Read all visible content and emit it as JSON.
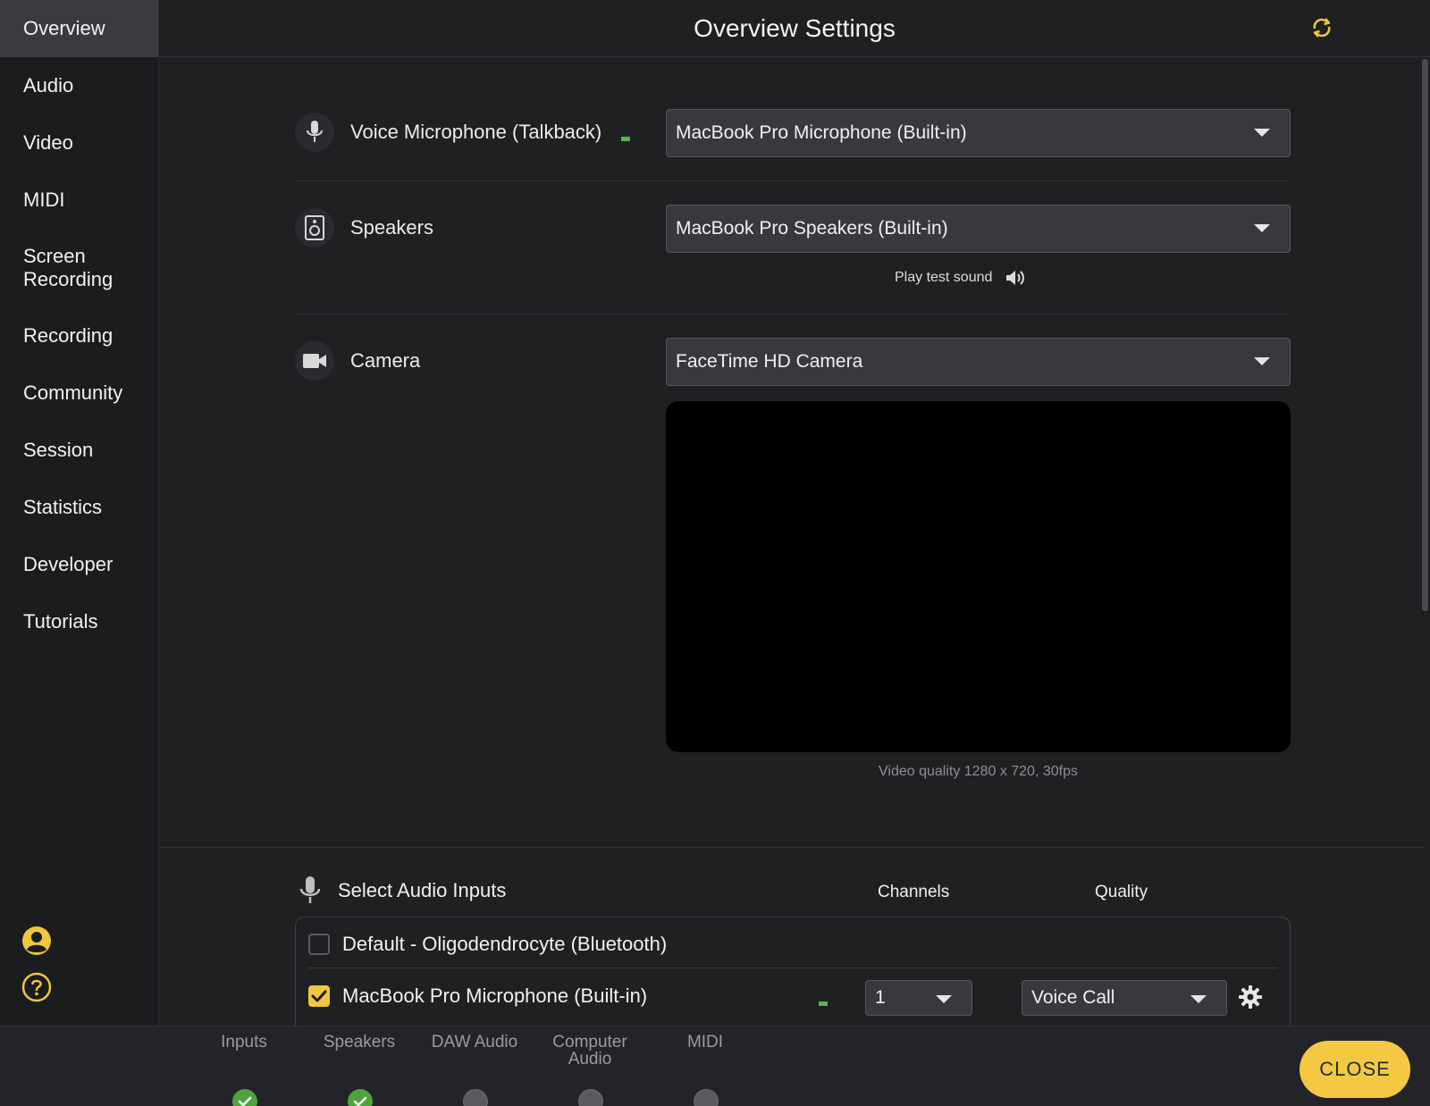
{
  "sidebar": {
    "items": [
      {
        "label": "Overview"
      },
      {
        "label": "Audio"
      },
      {
        "label": "Video"
      },
      {
        "label": "MIDI"
      },
      {
        "label": "Screen Recording"
      },
      {
        "label": "Recording"
      },
      {
        "label": "Community"
      },
      {
        "label": "Session"
      },
      {
        "label": "Statistics"
      },
      {
        "label": "Developer"
      },
      {
        "label": "Tutorials"
      }
    ],
    "active_index": 0,
    "icons": [
      "account-icon",
      "help-icon"
    ]
  },
  "header": {
    "title": "Overview Settings",
    "icon": "refresh-icon",
    "accent": "#f2c53d"
  },
  "voice_mic": {
    "label": "Voice Microphone (Talkback)",
    "selected": "MacBook Pro Microphone (Built-in)",
    "icon": "microphone-icon"
  },
  "speakers": {
    "label": "Speakers",
    "selected": "MacBook Pro Speakers (Built-in)",
    "test_sound_label": "Play test sound",
    "icon": "speaker-icon"
  },
  "camera": {
    "label": "Camera",
    "selected": "FaceTime HD Camera",
    "video_quality": "Video quality 1280 x 720, 30fps",
    "icon": "camera-icon"
  },
  "audio_inputs": {
    "title": "Select Audio Inputs",
    "channels_header": "Channels",
    "quality_header": "Quality",
    "rows": [
      {
        "name": "Default - Oligodendrocyte (Bluetooth)",
        "checked": false
      },
      {
        "name": "MacBook Pro Microphone (Built-in)",
        "checked": true,
        "channels": "1",
        "quality": "Voice Call"
      }
    ]
  },
  "footer": {
    "status": [
      {
        "label": "Inputs",
        "state": "ok"
      },
      {
        "label": "Speakers",
        "state": "ok"
      },
      {
        "label": "DAW Audio",
        "state": "off"
      },
      {
        "label": "Computer Audio",
        "state": "off"
      },
      {
        "label": "MIDI",
        "state": "off"
      }
    ],
    "close_label": "CLOSE"
  }
}
